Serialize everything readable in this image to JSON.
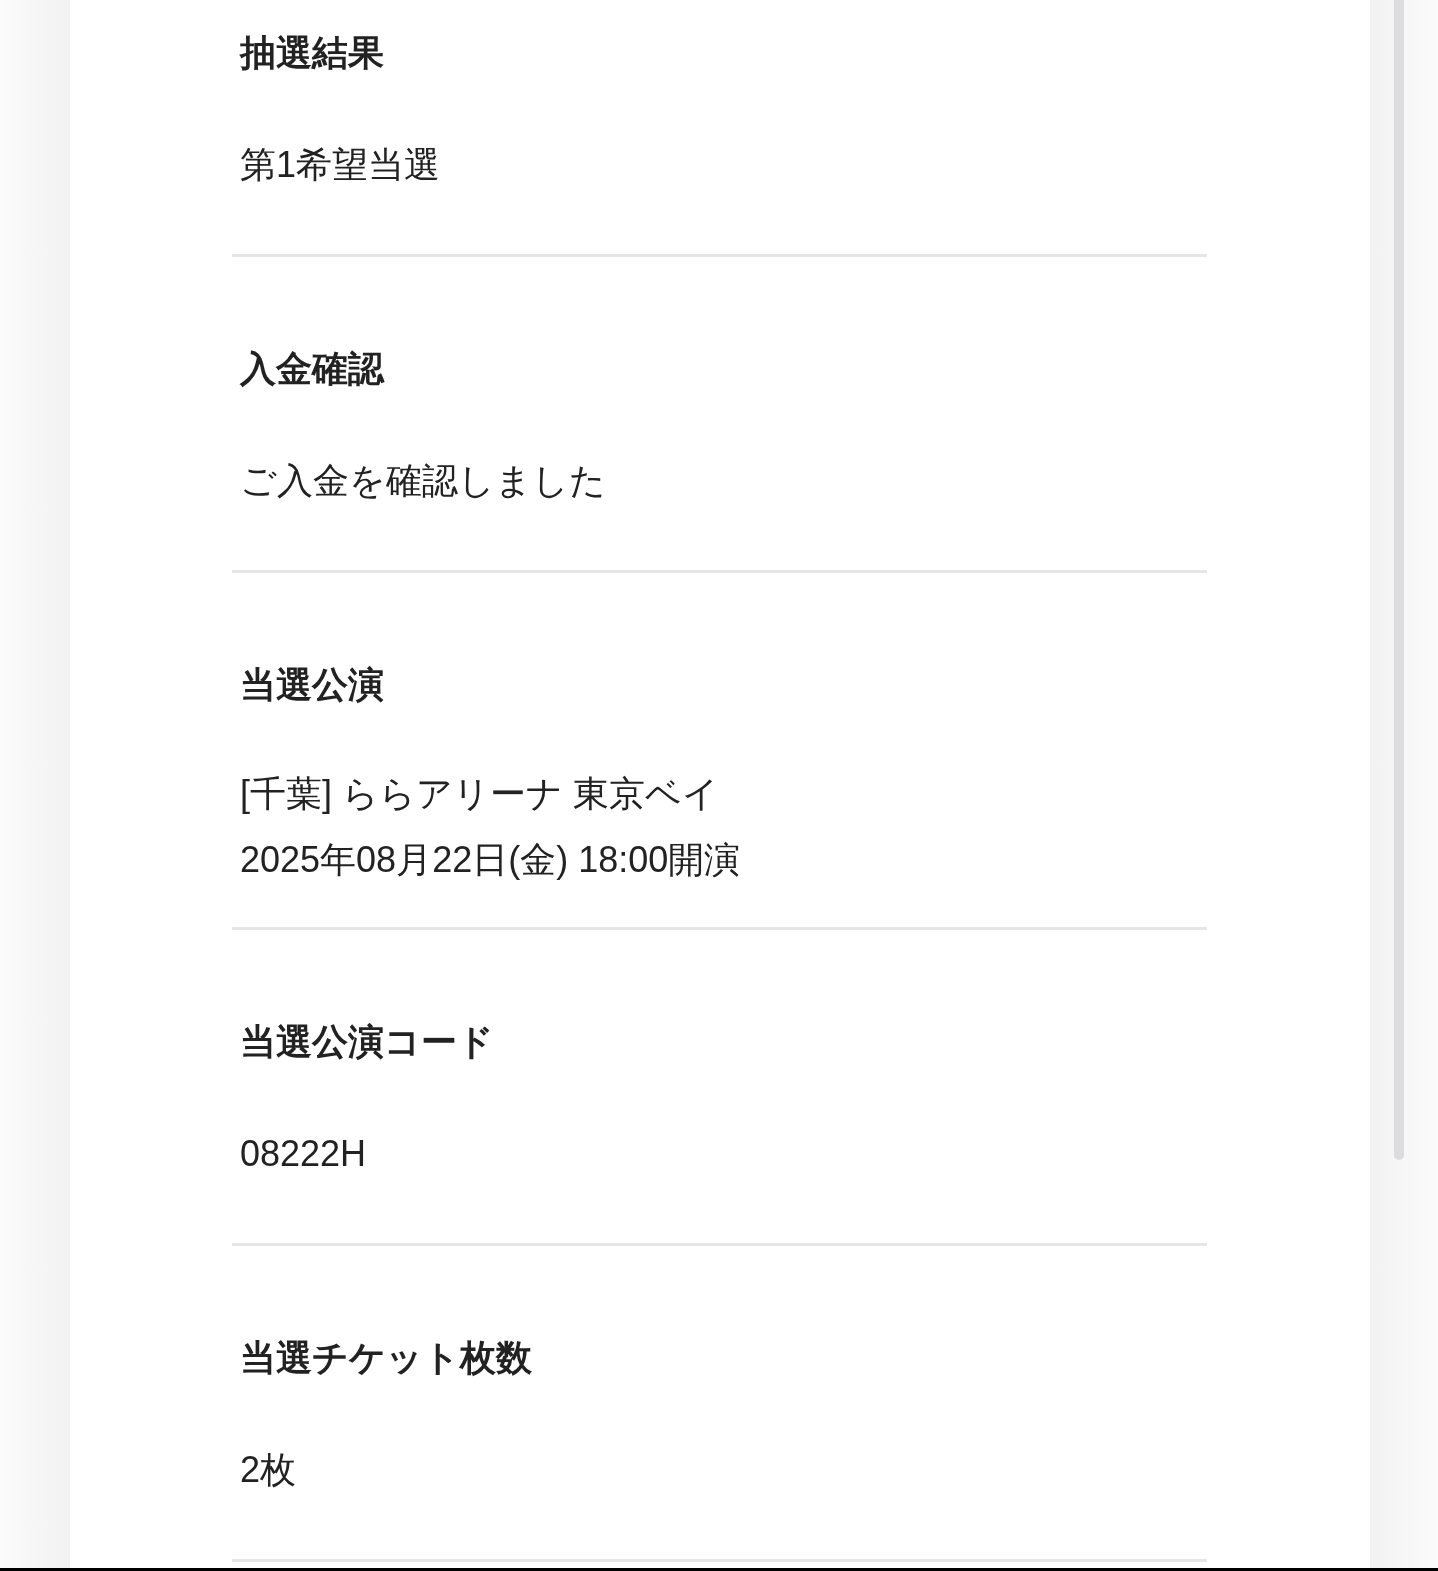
{
  "sections": [
    {
      "label": "抽選結果",
      "lines": [
        "第1希望当選"
      ]
    },
    {
      "label": "入金確認",
      "lines": [
        "ご入金を確認しました"
      ]
    },
    {
      "label": "当選公演",
      "lines": [
        "[千葉] ららアリーナ 東京ベイ",
        "2025年08月22日(金) 18:00開演"
      ]
    },
    {
      "label": "当選公演コード",
      "lines": [
        "08222H"
      ]
    },
    {
      "label": "当選チケット枚数",
      "lines": [
        "2枚"
      ]
    }
  ]
}
